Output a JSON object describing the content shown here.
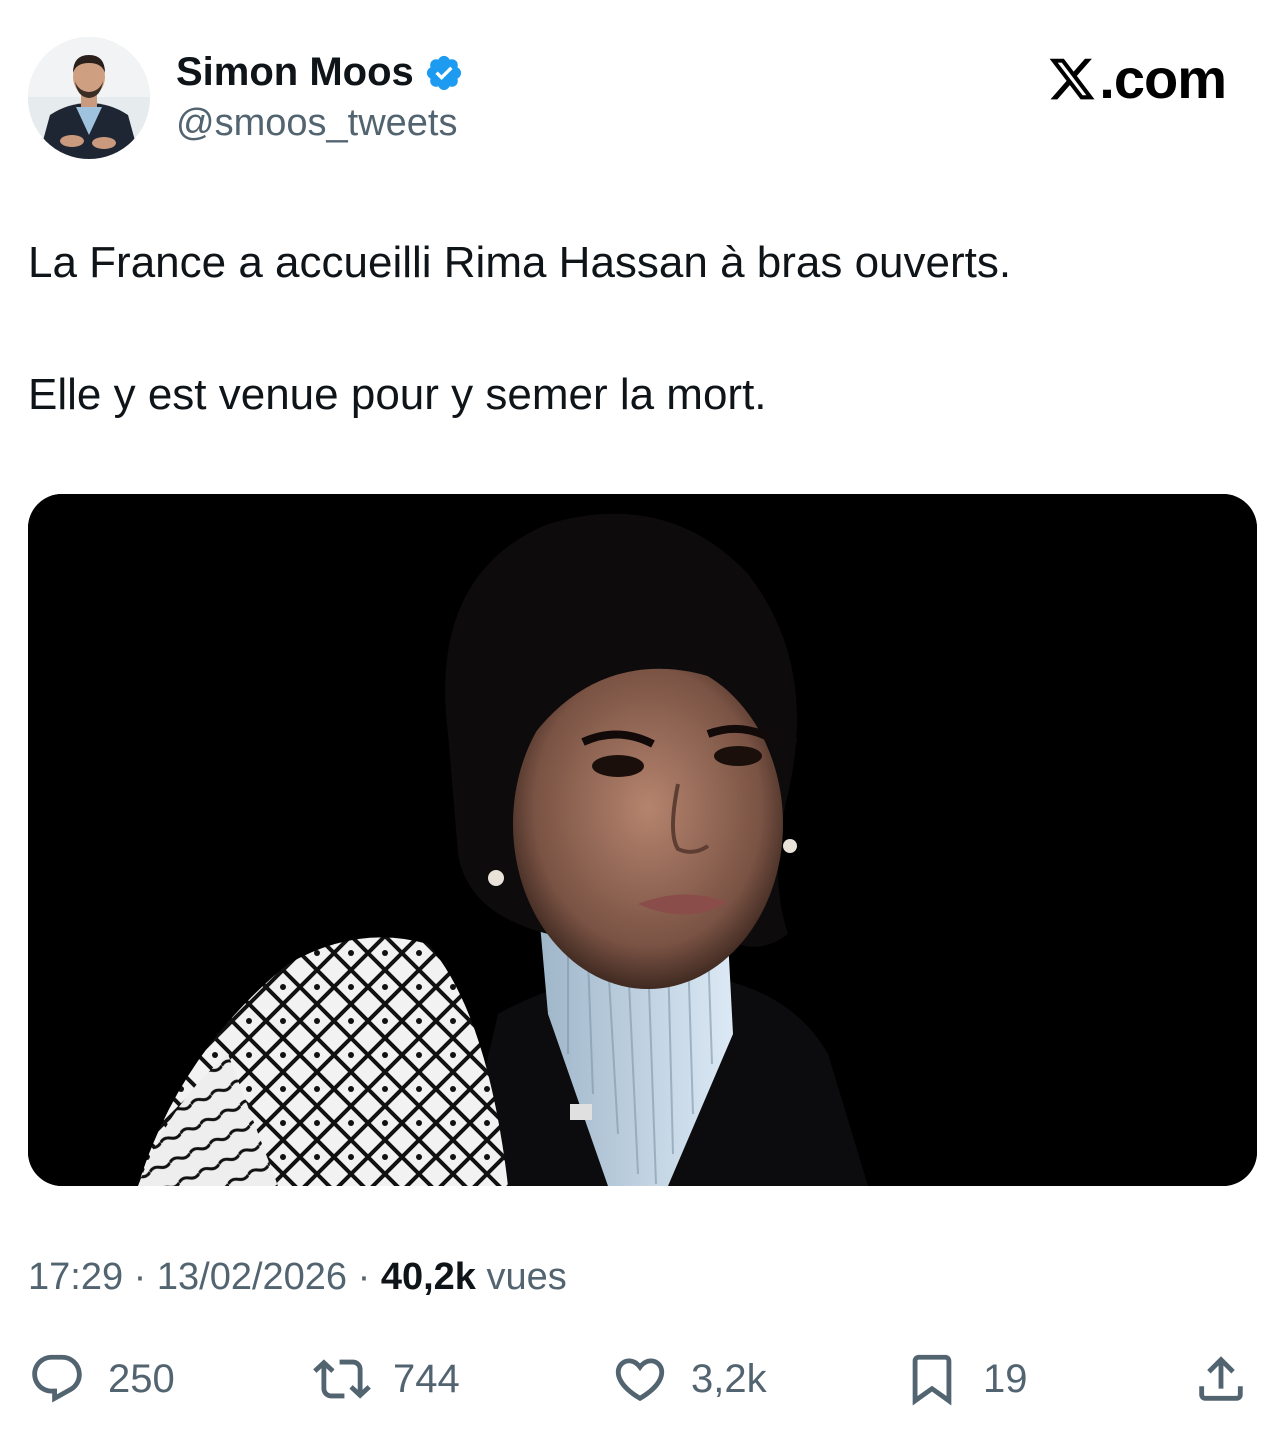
{
  "author": {
    "display_name": "Simon Moos",
    "handle": "@smoos_tweets",
    "verified_icon": "verified-badge-icon",
    "avatar_icon": "avatar-photo"
  },
  "brand": {
    "suffix": ".com",
    "icon": "x-logo-icon"
  },
  "tweet": {
    "line1": "La France a accueilli Rima Hassan à bras ouverts.",
    "line2": "Elle y est venue pour y semer la mort."
  },
  "media": {
    "icon": "embedded-photo"
  },
  "meta": {
    "time": "17:29",
    "separator": " · ",
    "date": "13/02/2026",
    "views_count": "40,2k",
    "views_label": " vues"
  },
  "actions": {
    "replies": "250",
    "reposts": "744",
    "likes": "3,2k",
    "bookmarks": "19"
  },
  "colors": {
    "text": "#0f1419",
    "secondary": "#536471",
    "verified": "#1d9bf0",
    "media_bg": "#000000"
  }
}
